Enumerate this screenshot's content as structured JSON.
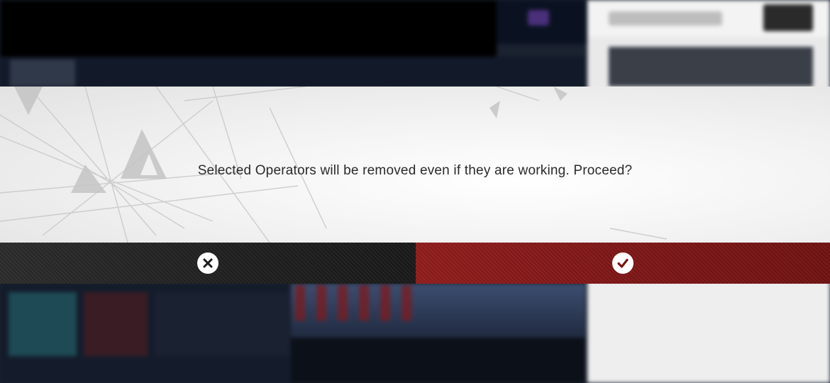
{
  "dialog": {
    "message": "Selected Operators will be removed even if they are working. Proceed?",
    "cancel_icon": "close-icon",
    "confirm_icon": "check-icon"
  },
  "colors": {
    "confirm_accent": "#7a1414",
    "cancel_background": "#1e1e1e",
    "dialog_background": "#f2f2f2"
  }
}
